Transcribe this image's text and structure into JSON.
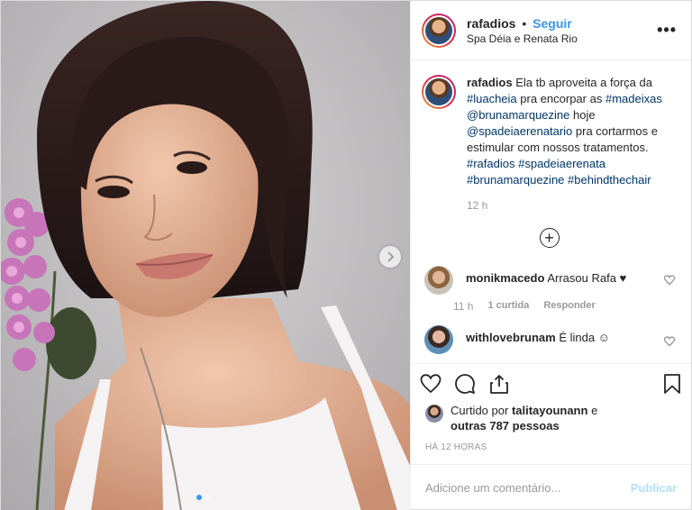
{
  "header": {
    "username": "rafadios",
    "separator": "•",
    "follow_label": "Seguir",
    "location": "Spa Déia e Renata Rio",
    "more_label": "•••"
  },
  "caption": {
    "username": "rafadios",
    "parts": [
      "Ela tb aproveita a força da",
      "#luacheia",
      "pra encorpar as",
      "#madeixas",
      "@brunamarquezine",
      "hoje",
      "@spadeiaerenatario",
      "pra cortarmos e estimular com nossos tratamentos.",
      "#rafadios",
      "#spadeiaerenata",
      "#brunamarquezine",
      "#behindthechair"
    ],
    "time": "12 h"
  },
  "load_more_label": "+",
  "comments": [
    {
      "username": "monikmacedo",
      "text": "Arrasou Rafa ♥",
      "time": "11 h",
      "likes": "1 curtida",
      "reply": "Responder"
    },
    {
      "username": "withlovebrunam",
      "text": "É linda ☺"
    }
  ],
  "likes": {
    "prefix": "Curtido por",
    "user": "talitayounann",
    "conj": "e",
    "others": "outras 787 pessoas"
  },
  "ago": "HÁ 12 HORAS",
  "add_comment": {
    "placeholder": "Adicione um comentário...",
    "publish_label": "Publicar"
  },
  "icons": {
    "heart": "heart-icon",
    "comment": "comment-icon",
    "share": "share-icon",
    "save": "bookmark-icon",
    "next": "chevron-right-icon",
    "add": "plus-circle-icon"
  },
  "carousel": {
    "total": 2,
    "current": 1
  },
  "colors": {
    "accent": "#3897f0",
    "hashtag": "#003569",
    "muted": "#999999",
    "publish_disabled": "#b2dffc"
  }
}
